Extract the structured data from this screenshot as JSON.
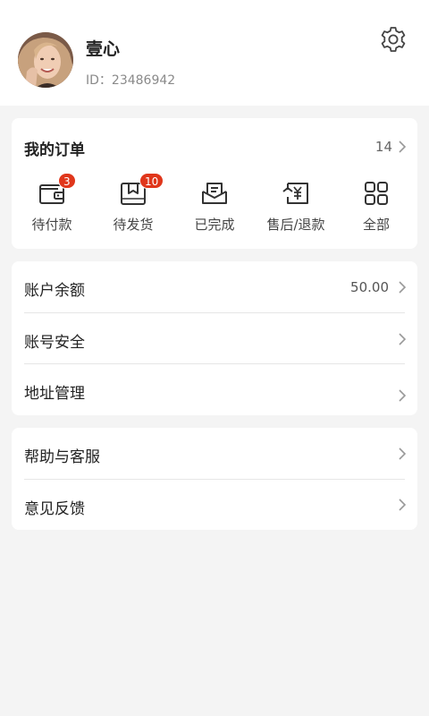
{
  "profile": {
    "name": "壹心",
    "id": "ID：23486942"
  },
  "orders": {
    "title": "我的订单",
    "count": "14",
    "items": [
      {
        "label": "待付款",
        "badge": "3",
        "icon": "wallet-icon"
      },
      {
        "label": "待发货",
        "badge": "10",
        "icon": "package-icon"
      },
      {
        "label": "已完成",
        "badge": "",
        "icon": "mail-box-icon"
      },
      {
        "label": "售后/退款",
        "badge": "",
        "icon": "refund-icon"
      },
      {
        "label": "全部",
        "badge": "",
        "icon": "grid-icon"
      }
    ]
  },
  "account": {
    "balance_label": "账户余额",
    "balance_value": "50.00",
    "security_label": "账号安全",
    "address_label": "地址管理"
  },
  "help": {
    "support_label": "帮助与客服",
    "feedback_label": "意见反馈"
  },
  "colors": {
    "badge": "#e0361b",
    "background": "#f4f4f4",
    "card": "#ffffff"
  }
}
